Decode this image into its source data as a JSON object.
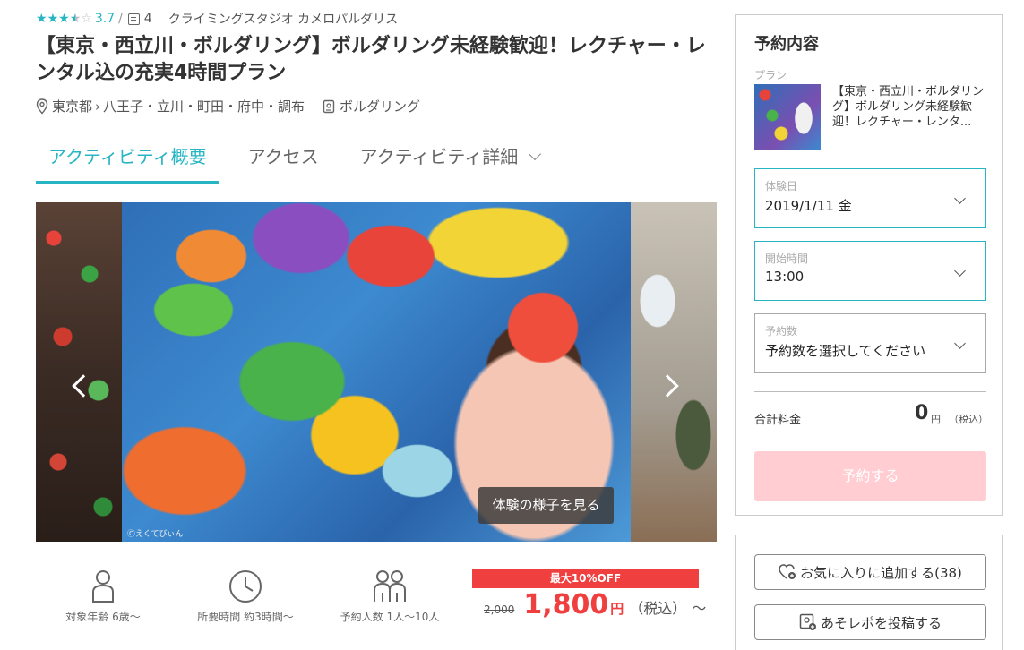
{
  "meta": {
    "rating": "3.7",
    "rating_stars": 3.5,
    "review_count": "4",
    "shop_name": "クライミングスタジオ カメロパルダリス"
  },
  "title": "【東京・西立川・ボルダリング】ボルダリング未経験歓迎！レクチャー・レンタル込の充実4時間プラン",
  "location": {
    "pref": "東京都",
    "area": "八王子・立川・町田・府中・調布",
    "category": "ボルダリング"
  },
  "tabs": [
    {
      "label": "アクティビティ概要"
    },
    {
      "label": "アクセス"
    },
    {
      "label": "アクティビティ詳細"
    }
  ],
  "gallery": {
    "view_button": "体験の様子を見る",
    "credit": "Ⓒえくてびぃん"
  },
  "info": {
    "age": "対象年齢 6歳〜",
    "duration": "所要時間 約3時間〜",
    "people": "予約人数 1人〜10人"
  },
  "price": {
    "discount_label": "最大10%OFF",
    "original": "2,000",
    "current": "1,800",
    "yen": "円",
    "tax": "（税込）",
    "tilde": "〜"
  },
  "booking": {
    "title": "予約内容",
    "plan_label": "プラン",
    "plan_name": "【東京・西立川・ボルダリング】ボルダリング未経験歓迎！レクチャー・レンタ...",
    "date_label": "体験日",
    "date_value": "2019/1/11 金",
    "time_label": "開始時間",
    "time_value": "13:00",
    "count_label": "予約数",
    "count_value": "予約数を選択してください",
    "total_label": "合計料金",
    "total_amount": "0",
    "total_yen": "円",
    "total_tax": "（税込）",
    "book_button": "予約する"
  },
  "actions": {
    "favorite": "お気に入りに追加する(38)",
    "report": "あそレポを投稿する"
  },
  "colors": {
    "accent": "#27b5c4",
    "price_red": "#ef3f3f",
    "book_disabled": "#ffcdd2"
  }
}
